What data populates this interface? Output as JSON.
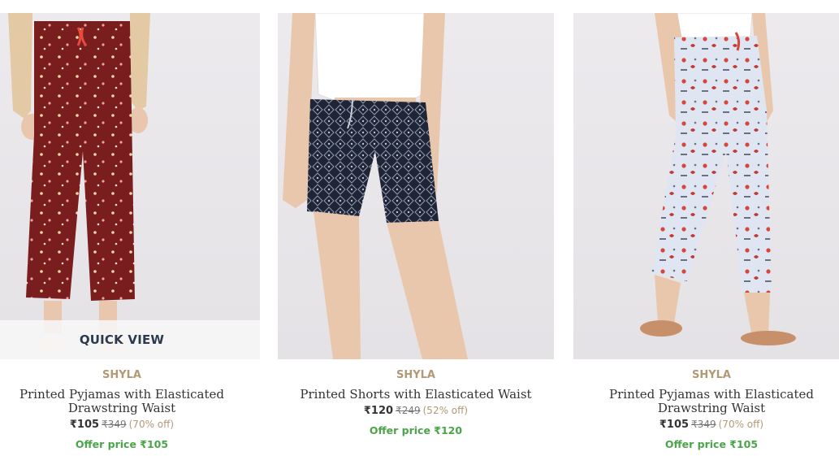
{
  "quick_view_label": "QUICK VIEW",
  "colors": {
    "brand": "#b19975",
    "offer": "#4aa548",
    "text": "#333333",
    "muted": "#777777"
  },
  "products": [
    {
      "brand": "SHYLA",
      "name": "Printed Pyjamas with Elasticated Drawstring Waist",
      "price": "₹105",
      "mrp": "₹349",
      "discount": "(70% off)",
      "offer": "Offer price ₹105",
      "image": "maroon-printed-pyjamas"
    },
    {
      "brand": "SHYLA",
      "name": "Printed Shorts with Elasticated Waist",
      "price": "₹120",
      "mrp": "₹249",
      "discount": "(52% off)",
      "offer": "Offer price ₹120",
      "image": "navy-printed-shorts"
    },
    {
      "brand": "SHYLA",
      "name": "Printed Pyjamas with Elasticated Drawstring Waist",
      "price": "₹105",
      "mrp": "₹349",
      "discount": "(70% off)",
      "offer": "Offer price ₹105",
      "image": "light-blue-printed-pyjamas"
    }
  ]
}
